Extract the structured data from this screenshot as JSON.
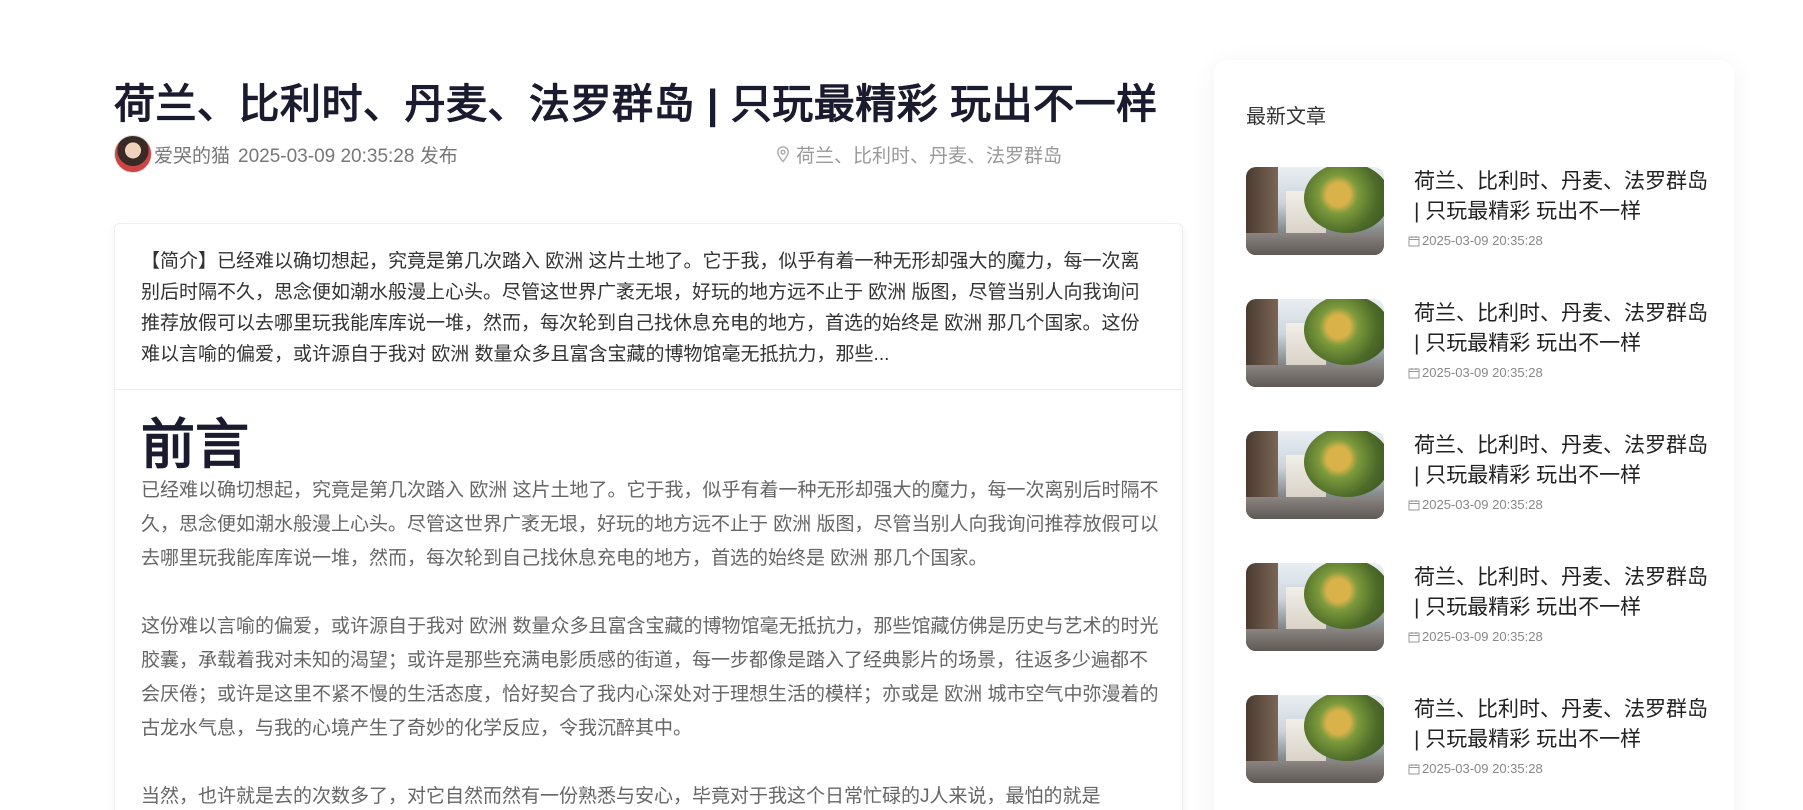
{
  "article": {
    "title": "荷兰、比利时、丹麦、法罗群岛 | 只玩最精彩 玩出不一样",
    "author": "爱哭的猫",
    "date": "2025-03-09 20:35:28",
    "published_suffix": "发布",
    "location": "荷兰、比利时、丹麦、法罗群岛",
    "summary": "【简介】已经难以确切想起，究竟是第几次踏入 欧洲 这片土地了。它于我，似乎有着一种无形却强大的魔力，每一次离别后时隔不久，思念便如潮水般漫上心头。尽管这世界广袤无垠，好玩的地方远不止于 欧洲 版图，尽管当别人向我询问推荐放假可以去哪里玩我能库库说一堆，然而，每次轮到自己找休息充电的地方，首选的始终是 欧洲 那几个国家。这份难以言喻的偏爱，或许源自于我对 欧洲 数量众多且富含宝藏的博物馆毫无抵抗力，那些...",
    "section_heading": "前言",
    "paragraphs": [
      "已经难以确切想起，究竟是第几次踏入 欧洲 这片土地了。它于我，似乎有着一种无形却强大的魔力，每一次离别后时隔不久，思念便如潮水般漫上心头。尽管这世界广袤无垠，好玩的地方远不止于 欧洲 版图，尽管当别人向我询问推荐放假可以去哪里玩我能库库说一堆，然而，每次轮到自己找休息充电的地方，首选的始终是 欧洲 那几个国家。",
      "这份难以言喻的偏爱，或许源自于我对 欧洲 数量众多且富含宝藏的博物馆毫无抵抗力，那些馆藏仿佛是历史与艺术的时光胶囊，承载着我对未知的渴望；或许是那些充满电影质感的街道，每一步都像是踏入了经典影片的场景，往返多少遍都不会厌倦；或许是这里不紧不慢的生活态度，恰好契合了我内心深处对于理想生活的模样；亦或是 欧洲 城市空气中弥漫着的古龙水气息，与我的心境产生了奇妙的化学反应，令我沉醉其中。",
      "当然，也许就是去的次数多了，对它自然而然有一份熟悉与安心，毕竟对于我这个日常忙碌的J人来说，最怕的就是"
    ]
  },
  "sidebar": {
    "title": "最新文章",
    "items": [
      {
        "title": "荷兰、比利时、丹麦、法罗群岛 | 只玩最精彩 玩出不一样",
        "date": "2025-03-09 20:35:28"
      },
      {
        "title": "荷兰、比利时、丹麦、法罗群岛 | 只玩最精彩 玩出不一样",
        "date": "2025-03-09 20:35:28"
      },
      {
        "title": "荷兰、比利时、丹麦、法罗群岛 | 只玩最精彩 玩出不一样",
        "date": "2025-03-09 20:35:28"
      },
      {
        "title": "荷兰、比利时、丹麦、法罗群岛 | 只玩最精彩 玩出不一样",
        "date": "2025-03-09 20:35:28"
      },
      {
        "title": "荷兰、比利时、丹麦、法罗群岛 | 只玩最精彩 玩出不一样",
        "date": "2025-03-09 20:35:28"
      }
    ]
  },
  "icons": {
    "location": "map-pin-icon",
    "date": "calendar-icon"
  }
}
